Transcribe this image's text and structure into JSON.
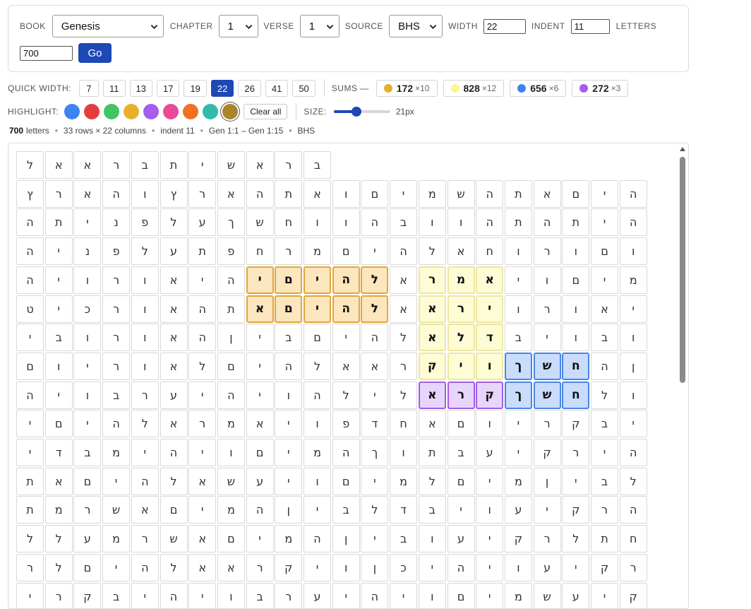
{
  "controls": {
    "book_label": "BOOK",
    "book_value": "Genesis",
    "chapter_label": "CHAPTER",
    "chapter_value": "1",
    "verse_label": "VERSE",
    "verse_value": "1",
    "source_label": "SOURCE",
    "source_value": "BHS",
    "width_label": "WIDTH",
    "width_value": "22",
    "indent_label": "INDENT",
    "indent_value": "11",
    "letters_label": "LETTERS",
    "letters_value": "700",
    "go_label": "Go"
  },
  "quick_width": {
    "label": "QUICK WIDTH:",
    "options": [
      "7",
      "11",
      "13",
      "17",
      "19",
      "22",
      "26",
      "41",
      "50"
    ],
    "active": "22"
  },
  "sums": {
    "label": "SUMS —",
    "items": [
      {
        "value": "172",
        "mult": "×10",
        "color": "#e5b02c"
      },
      {
        "value": "828",
        "mult": "×12",
        "color": "#fdf58f"
      },
      {
        "value": "656",
        "mult": "×6",
        "color": "#3d84f2"
      },
      {
        "value": "272",
        "mult": "×3",
        "color": "#a55ded"
      }
    ]
  },
  "highlight": {
    "label": "HIGHLIGHT:",
    "swatches": [
      "#3c85f0",
      "#e53d3d",
      "#3fc466",
      "#e9b02b",
      "#a55ded",
      "#ea4a9b",
      "#f27022",
      "#33bba9",
      "#a8852a"
    ],
    "selected": 8,
    "clear_label": "Clear all",
    "size_label": "SIZE:",
    "size_value": "21px",
    "size_fraction": 0.4
  },
  "info": {
    "letters_count": "700",
    "letters_word": "letters",
    "dims": "33 rows × 22 columns",
    "indent": "indent 11",
    "range": "Gen 1:1 – Gen 1:15",
    "source": "BHS"
  },
  "grid": {
    "rows": [
      "ב,ר,א,ש,י,ת,ב,ר,א,א,ל",
      "ה,י,ם,א,ת,ה,ש,מ,י,ם,ו,א,ת,ה,א,ר,ץ,ו,ה,א,ר,ץ",
      "ה,י,ת,ה,ת,ה,ו,ו,ב,ה,ו,ו,ח,ש,ך,ע,ל,פ,נ,י,ת,ה",
      "ו,ם,ו,ר,ו,ח,א,ל,ה,י,ם,מ,ר,ח,פ,ת,ע,ל,פ,נ,י,ה",
      "מ,י,ם,ו,י,א,מ,ר,א,ל,ה,י,ם,י,ה,י,א,ו,ר,ו,י,ה",
      "י,א,ו,ר,ו,י,ר,א,א,ל,ה,י,ם,א,ת,ה,א,ו,ר,כ,י,ט",
      "ו,ב,ו,י,ב,ד,ל,א,ל,ה,י,ם,ב,י,ן,ה,א,ו,ר,ו,ב,י",
      "ן,ה,ח,ש,ך,ו,י,ק,ר,א,א,ל,ה,י,ם,ל,א,ו,ר,י,ו,ם",
      "ו,ל,ח,ש,ך,ק,ר,א,ל,י,ל,ה,ו,י,ה,י,ע,ר,ב,ו,י,ה",
      "י,ב,ק,ר,י,ו,ם,א,ח,ד,פ,ו,י,א,מ,ר,א,ל,ה,י,ם,י",
      "ה,י,ר,ק,י,ע,ב,ת,ו,ך,ה,מ,י,ם,ו,י,ה,י,מ,ב,ד,י",
      "ל,ב,י,ן,מ,י,ם,ל,מ,י,ם,ו,י,ע,ש,א,ל,ה,י,ם,א,ת",
      "ה,ר,ק,י,ע,ו,י,ב,ד,ל,ב,י,ן,ה,מ,י,ם,א,ש,ר,מ,ת",
      "ח,ת,ל,ר,ק,י,ע,ו,ב,י,ן,ה,מ,י,ם,א,ש,ר,מ,ע,ל,ל",
      "ר,ק,י,ע,ו,י,ה,י,כ,ן,ו,י,ק,ר,א,א,ל,ה,י,ם,ל,ר",
      "ק,י,ע,ש,מ,י,ם,ו,י,ה,י,ע,ר,ב,ו,י,ה,י,ב,ק,ר,י"
    ],
    "highlights": [
      {
        "row": 4,
        "col": 9,
        "color": "orange"
      },
      {
        "row": 4,
        "col": 10,
        "color": "orange"
      },
      {
        "row": 4,
        "col": 11,
        "color": "orange"
      },
      {
        "row": 4,
        "col": 12,
        "color": "orange"
      },
      {
        "row": 4,
        "col": 13,
        "color": "orange"
      },
      {
        "row": 5,
        "col": 9,
        "color": "orange"
      },
      {
        "row": 5,
        "col": 10,
        "color": "orange"
      },
      {
        "row": 5,
        "col": 11,
        "color": "orange"
      },
      {
        "row": 5,
        "col": 12,
        "color": "orange"
      },
      {
        "row": 5,
        "col": 13,
        "color": "orange"
      },
      {
        "row": 4,
        "col": 5,
        "color": "yellow"
      },
      {
        "row": 4,
        "col": 6,
        "color": "yellow"
      },
      {
        "row": 4,
        "col": 7,
        "color": "yellow"
      },
      {
        "row": 5,
        "col": 5,
        "color": "yellow"
      },
      {
        "row": 5,
        "col": 6,
        "color": "yellow"
      },
      {
        "row": 5,
        "col": 7,
        "color": "yellow"
      },
      {
        "row": 6,
        "col": 5,
        "color": "yellow"
      },
      {
        "row": 6,
        "col": 6,
        "color": "yellow"
      },
      {
        "row": 6,
        "col": 7,
        "color": "yellow"
      },
      {
        "row": 7,
        "col": 5,
        "color": "yellow"
      },
      {
        "row": 7,
        "col": 6,
        "color": "yellow"
      },
      {
        "row": 7,
        "col": 7,
        "color": "yellow"
      },
      {
        "row": 8,
        "col": 5,
        "color": "purple"
      },
      {
        "row": 8,
        "col": 6,
        "color": "purple"
      },
      {
        "row": 8,
        "col": 7,
        "color": "purple"
      },
      {
        "row": 7,
        "col": 2,
        "color": "blue"
      },
      {
        "row": 7,
        "col": 3,
        "color": "blue"
      },
      {
        "row": 7,
        "col": 4,
        "color": "blue"
      },
      {
        "row": 8,
        "col": 2,
        "color": "blue"
      },
      {
        "row": 8,
        "col": 3,
        "color": "blue"
      },
      {
        "row": 8,
        "col": 4,
        "color": "blue"
      }
    ],
    "highlight_styles": {
      "orange": {
        "bg": "#fbe6bd",
        "border": "#e0a73a"
      },
      "yellow": {
        "bg": "#fdfcd4",
        "border": "#ede6a4"
      },
      "purple": {
        "bg": "#e7d5fb",
        "border": "#a05ce6"
      },
      "blue": {
        "bg": "#c9dcfb",
        "border": "#4a86e4"
      }
    }
  }
}
